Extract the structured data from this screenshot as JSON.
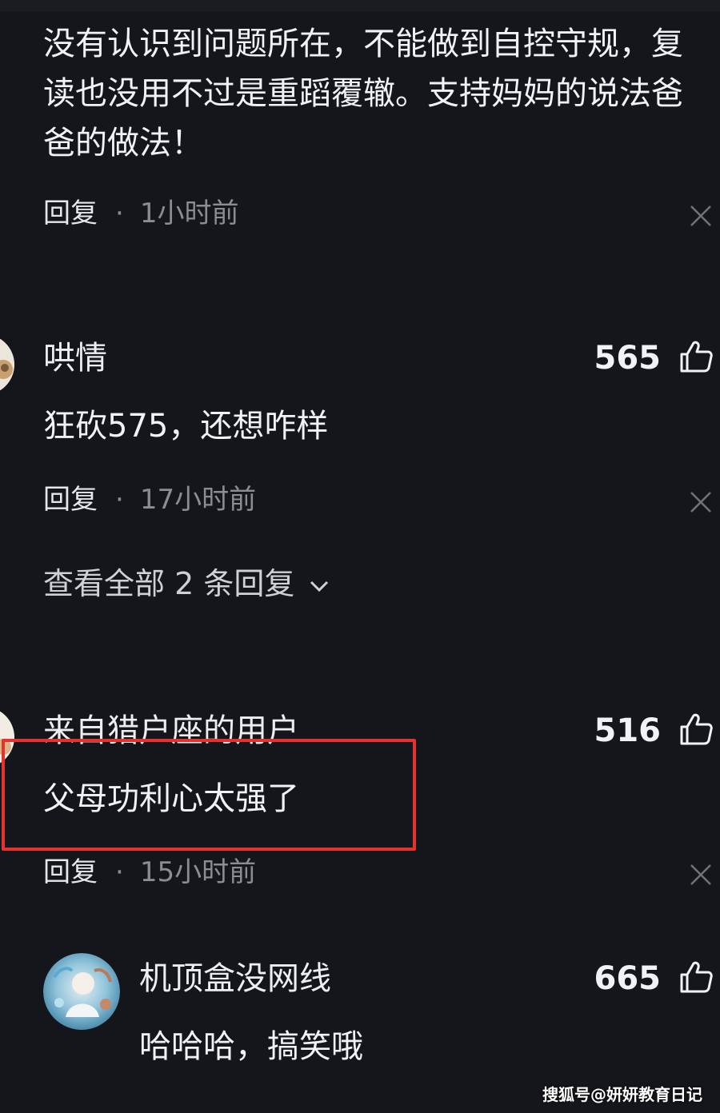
{
  "comments": [
    {
      "text_lines": [
        "没有认识到问题所在，不能做到自控守规，复",
        "读也没用不过是重蹈覆辙。支持妈妈的说法爸",
        "爸的做法！"
      ],
      "reply_label": "回复",
      "separator": "·",
      "time": "1小时前"
    },
    {
      "username": "哄情",
      "likes": "565",
      "text": "狂砍575，还想咋样",
      "reply_label": "回复",
      "separator": "·",
      "time": "17小时前",
      "view_replies": "查看全部 2 条回复"
    },
    {
      "username": "来自猎户座的用户",
      "likes": "516",
      "text": "父母功利心太强了",
      "reply_label": "回复",
      "separator": "·",
      "time": "15小时前"
    },
    {
      "username": "机顶盒没网线",
      "likes": "665",
      "text": "哈哈哈，搞笑哦"
    }
  ],
  "watermark": "搜狐号@妍妍教育日记",
  "colors": {
    "background": "#15161b",
    "highlight": "#e5322d",
    "muted": "#8b8d93"
  },
  "icons": [
    "thumbs-up-icon",
    "close-icon",
    "chevron-down-icon"
  ]
}
